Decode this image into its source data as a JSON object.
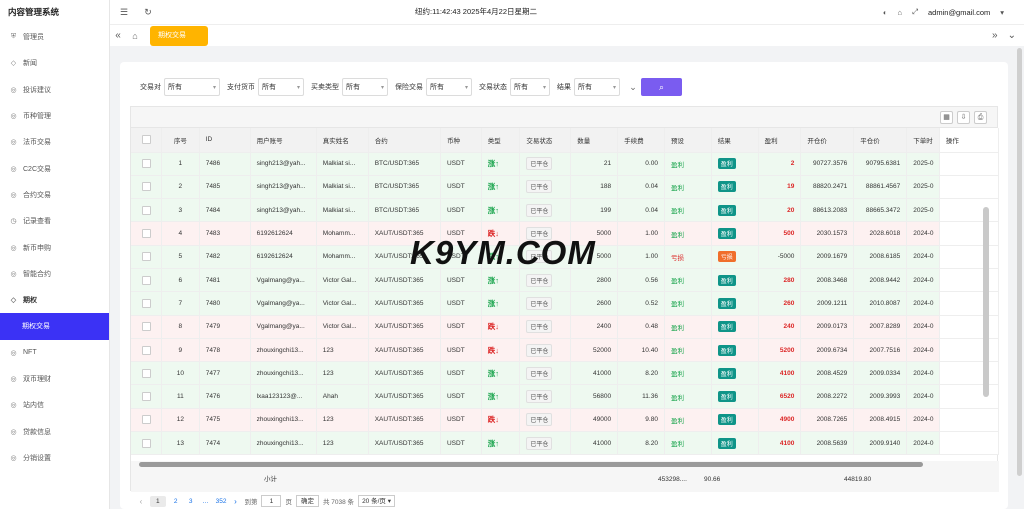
{
  "brand": "内容管理系统",
  "sidebar": {
    "items": [
      {
        "label": "管理员",
        "icon": "shield-check-icon"
      },
      {
        "label": "新闻",
        "icon": "tag-icon"
      },
      {
        "label": "投诉建议",
        "icon": "eye-icon"
      },
      {
        "label": "币种管理",
        "icon": "eye-icon"
      },
      {
        "label": "法币交易",
        "icon": "eye-icon"
      },
      {
        "label": "C2C交易",
        "icon": "eye-icon"
      },
      {
        "label": "合约交易",
        "icon": "eye-icon"
      },
      {
        "label": "记录查看",
        "icon": "clock-icon"
      },
      {
        "label": "新币申购",
        "icon": "eye-icon"
      },
      {
        "label": "智能合约",
        "icon": "eye-icon"
      },
      {
        "label": "期权",
        "icon": "tag-icon"
      },
      {
        "label": "期权交易",
        "icon": "",
        "active": true,
        "sub": true
      },
      {
        "label": "NFT",
        "icon": "eye-icon"
      },
      {
        "label": "双币理财",
        "icon": "eye-icon"
      },
      {
        "label": "站内信",
        "icon": "eye-icon"
      },
      {
        "label": "贷款信息",
        "icon": "eye-icon"
      },
      {
        "label": "分销设置",
        "icon": "eye-icon"
      }
    ]
  },
  "topbar": {
    "clock": "纽约:11:42:43 2025年4月22日星期二",
    "user": "admin@gmail.com"
  },
  "tabs": {
    "active": "期权交易"
  },
  "filters": [
    {
      "label": "交易对",
      "value": "所有"
    },
    {
      "label": "支付货币",
      "value": "所有"
    },
    {
      "label": "买卖类型",
      "value": "所有"
    },
    {
      "label": "保险交易",
      "value": "所有"
    },
    {
      "label": "交易状态",
      "value": "所有"
    },
    {
      "label": "结果",
      "value": "所有"
    }
  ],
  "table": {
    "headers": [
      "序号",
      "ID",
      "用户账号",
      "真实姓名",
      "合约",
      "币种",
      "类型",
      "交易状态",
      "数量",
      "手续费",
      "预设",
      "结果",
      "盈利",
      "开仓价",
      "平仓价",
      "下单时",
      "操作"
    ],
    "rows": [
      {
        "no": "1",
        "id": "7486",
        "user": "singh213@yah...",
        "name": "Malkiat si...",
        "contract": "BTC/USDT:365",
        "coin": "USDT",
        "type": "涨↑",
        "dir": "up",
        "status": "已平仓",
        "qty": "21",
        "fee": "0.00",
        "preset": "盈利",
        "pre": "win",
        "result": "盈利",
        "res": "win",
        "pl": "2",
        "pos": true,
        "open": "90727.3576",
        "close": "90795.6381",
        "time": "2025-0"
      },
      {
        "no": "2",
        "id": "7485",
        "user": "singh213@yah...",
        "name": "Malkiat si...",
        "contract": "BTC/USDT:365",
        "coin": "USDT",
        "type": "涨↑",
        "dir": "up",
        "status": "已平仓",
        "qty": "188",
        "fee": "0.04",
        "preset": "盈利",
        "pre": "win",
        "result": "盈利",
        "res": "win",
        "pl": "19",
        "pos": true,
        "open": "88820.2471",
        "close": "88861.4567",
        "time": "2025-0"
      },
      {
        "no": "3",
        "id": "7484",
        "user": "singh213@yah...",
        "name": "Malkiat si...",
        "contract": "BTC/USDT:365",
        "coin": "USDT",
        "type": "涨↑",
        "dir": "up",
        "status": "已平仓",
        "qty": "199",
        "fee": "0.04",
        "preset": "盈利",
        "pre": "win",
        "result": "盈利",
        "res": "win",
        "pl": "20",
        "pos": true,
        "open": "88613.2083",
        "close": "88665.3472",
        "time": "2025-0"
      },
      {
        "no": "4",
        "id": "7483",
        "user": "6192612624",
        "name": "Mohamm...",
        "contract": "XAUT/USDT:365",
        "coin": "USDT",
        "type": "跌↓",
        "dir": "down",
        "status": "已平仓",
        "qty": "5000",
        "fee": "1.00",
        "preset": "盈利",
        "pre": "win",
        "result": "盈利",
        "res": "win",
        "pl": "500",
        "pos": true,
        "open": "2030.1573",
        "close": "2028.6018",
        "time": "2024-0"
      },
      {
        "no": "5",
        "id": "7482",
        "user": "6192612624",
        "name": "Mohamm...",
        "contract": "XAUT/USDT:365",
        "coin": "USDT",
        "type": "涨↑",
        "dir": "up",
        "status": "已平仓",
        "qty": "5000",
        "fee": "1.00",
        "preset": "亏损",
        "pre": "loss",
        "result": "亏损",
        "res": "loss",
        "pl": "-5000",
        "pos": false,
        "open": "2009.1679",
        "close": "2008.6185",
        "time": "2024-0"
      },
      {
        "no": "6",
        "id": "7481",
        "user": "Vgalmang@ya...",
        "name": "Victor Gal...",
        "contract": "XAUT/USDT:365",
        "coin": "USDT",
        "type": "涨↑",
        "dir": "up",
        "status": "已平仓",
        "qty": "2800",
        "fee": "0.56",
        "preset": "盈利",
        "pre": "win",
        "result": "盈利",
        "res": "win",
        "pl": "280",
        "pos": true,
        "open": "2008.3468",
        "close": "2008.9442",
        "time": "2024-0"
      },
      {
        "no": "7",
        "id": "7480",
        "user": "Vgalmang@ya...",
        "name": "Victor Gal...",
        "contract": "XAUT/USDT:365",
        "coin": "USDT",
        "type": "涨↑",
        "dir": "up",
        "status": "已平仓",
        "qty": "2600",
        "fee": "0.52",
        "preset": "盈利",
        "pre": "win",
        "result": "盈利",
        "res": "win",
        "pl": "260",
        "pos": true,
        "open": "2009.1211",
        "close": "2010.8087",
        "time": "2024-0"
      },
      {
        "no": "8",
        "id": "7479",
        "user": "Vgalmang@ya...",
        "name": "Victor Gal...",
        "contract": "XAUT/USDT:365",
        "coin": "USDT",
        "type": "跌↓",
        "dir": "down",
        "status": "已平仓",
        "qty": "2400",
        "fee": "0.48",
        "preset": "盈利",
        "pre": "win",
        "result": "盈利",
        "res": "win",
        "pl": "240",
        "pos": true,
        "open": "2009.0173",
        "close": "2007.8289",
        "time": "2024-0"
      },
      {
        "no": "9",
        "id": "7478",
        "user": "zhouxingchi13...",
        "name": "123",
        "contract": "XAUT/USDT:365",
        "coin": "USDT",
        "type": "跌↓",
        "dir": "down",
        "status": "已平仓",
        "qty": "52000",
        "fee": "10.40",
        "preset": "盈利",
        "pre": "win",
        "result": "盈利",
        "res": "win",
        "pl": "5200",
        "pos": true,
        "open": "2009.6734",
        "close": "2007.7516",
        "time": "2024-0"
      },
      {
        "no": "10",
        "id": "7477",
        "user": "zhouxingchi13...",
        "name": "123",
        "contract": "XAUT/USDT:365",
        "coin": "USDT",
        "type": "涨↑",
        "dir": "up",
        "status": "已平仓",
        "qty": "41000",
        "fee": "8.20",
        "preset": "盈利",
        "pre": "win",
        "result": "盈利",
        "res": "win",
        "pl": "4100",
        "pos": true,
        "open": "2008.4529",
        "close": "2009.0334",
        "time": "2024-0"
      },
      {
        "no": "11",
        "id": "7476",
        "user": "lxaa123123@...",
        "name": "Ahah",
        "contract": "XAUT/USDT:365",
        "coin": "USDT",
        "type": "涨↑",
        "dir": "up",
        "status": "已平仓",
        "qty": "56800",
        "fee": "11.36",
        "preset": "盈利",
        "pre": "win",
        "result": "盈利",
        "res": "win",
        "pl": "6520",
        "pos": true,
        "open": "2008.2272",
        "close": "2009.3993",
        "time": "2024-0"
      },
      {
        "no": "12",
        "id": "7475",
        "user": "zhouxingchi13...",
        "name": "123",
        "contract": "XAUT/USDT:365",
        "coin": "USDT",
        "type": "跌↓",
        "dir": "down",
        "status": "已平仓",
        "qty": "49000",
        "fee": "9.80",
        "preset": "盈利",
        "pre": "win",
        "result": "盈利",
        "res": "win",
        "pl": "4900",
        "pos": true,
        "open": "2008.7265",
        "close": "2008.4915",
        "time": "2024-0"
      },
      {
        "no": "13",
        "id": "7474",
        "user": "zhouxingchi13...",
        "name": "123",
        "contract": "XAUT/USDT:365",
        "coin": "USDT",
        "type": "涨↑",
        "dir": "up",
        "status": "已平仓",
        "qty": "41000",
        "fee": "8.20",
        "preset": "盈利",
        "pre": "win",
        "result": "盈利",
        "res": "win",
        "pl": "4100",
        "pos": true,
        "open": "2008.5639",
        "close": "2009.9140",
        "time": "2024-0"
      }
    ],
    "subtotal": {
      "label": "小计",
      "qty": "453298....",
      "fee": "90.66",
      "pl": "44819.80"
    }
  },
  "pager": {
    "pages": [
      "1",
      "2",
      "3",
      "…",
      "352"
    ],
    "goto_label": "到第",
    "goto_value": "1",
    "page_unit": "页",
    "confirm": "确定",
    "total": "共 7038 条",
    "page_size": "20 条/页"
  },
  "watermark": "K9YM.COM"
}
